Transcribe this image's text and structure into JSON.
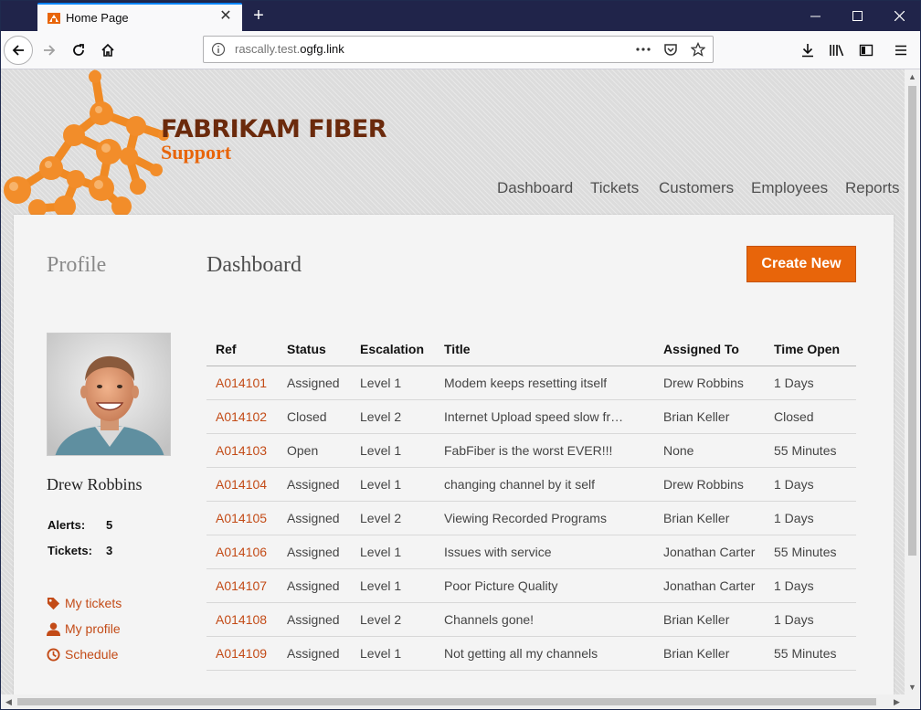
{
  "browser": {
    "tab_title": "Home Page",
    "new_tab_symbol": "+",
    "url_prefix": "rascally.test.",
    "url_domain": "ogfg.link",
    "toolbar_icons": [
      "back-icon",
      "forward-icon",
      "reload-icon",
      "home-icon",
      "info-icon",
      "more-icon",
      "pocket-icon",
      "bookmark-star-icon",
      "download-icon",
      "library-icon",
      "sidebar-icon",
      "menu-icon"
    ]
  },
  "brand": {
    "name": "FABRIKAM FIBER",
    "sub": "Support",
    "colors": {
      "primary_dark": "#6b2a0c",
      "accent": "#e8650a"
    }
  },
  "topnav": {
    "items": [
      "Dashboard",
      "Tickets",
      "Customers",
      "Employees",
      "Reports"
    ]
  },
  "profile": {
    "heading": "Profile",
    "name": "Drew Robbins",
    "alerts_label": "Alerts:",
    "alerts_value": "5",
    "tickets_label": "Tickets:",
    "tickets_value": "3",
    "links": [
      "My tickets",
      "My profile",
      "Schedule"
    ]
  },
  "dashboard": {
    "heading": "Dashboard",
    "create_label": "Create New",
    "columns": [
      "Ref",
      "Status",
      "Escalation",
      "Title",
      "Assigned To",
      "Time Open"
    ],
    "rows": [
      [
        "A014101",
        "Assigned",
        "Level 1",
        "Modem keeps resetting itself",
        "Drew Robbins",
        "1 Days"
      ],
      [
        "A014102",
        "Closed",
        "Level 2",
        "Internet Upload speed slow from...",
        "Brian Keller",
        "Closed"
      ],
      [
        "A014103",
        "Open",
        "Level 1",
        "FabFiber is the worst EVER!!!",
        "None",
        "55 Minutes"
      ],
      [
        "A014104",
        "Assigned",
        "Level 1",
        "changing channel by it self",
        "Drew Robbins",
        "1 Days"
      ],
      [
        "A014105",
        "Assigned",
        "Level 2",
        "Viewing Recorded Programs",
        "Brian Keller",
        "1 Days"
      ],
      [
        "A014106",
        "Assigned",
        "Level 1",
        "Issues with service",
        "Jonathan Carter",
        "55 Minutes"
      ],
      [
        "A014107",
        "Assigned",
        "Level 1",
        "Poor Picture Quality",
        "Jonathan Carter",
        "1 Days"
      ],
      [
        "A014108",
        "Assigned",
        "Level 2",
        "Channels gone!",
        "Brian Keller",
        "1 Days"
      ],
      [
        "A014109",
        "Assigned",
        "Level 1",
        "Not getting all my channels",
        "Brian Keller",
        "55 Minutes"
      ]
    ]
  }
}
